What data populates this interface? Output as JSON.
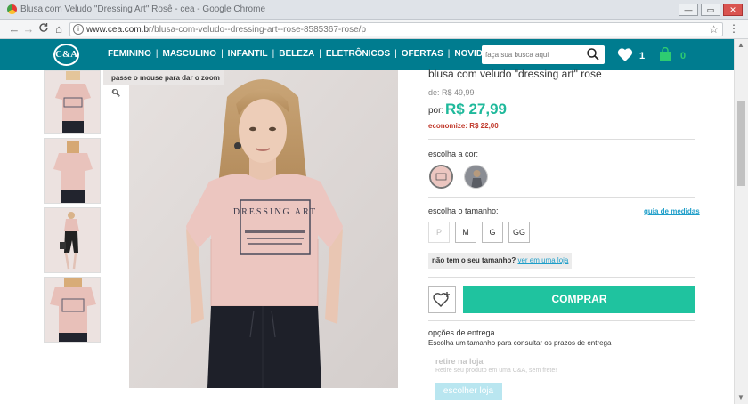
{
  "window": {
    "title": "Blusa com Veludo \"Dressing Art\" Rosê - cea - Google Chrome",
    "min_label": "—",
    "max_label": "▭",
    "close_label": "✕"
  },
  "browser": {
    "url_host": "www.cea.com.br",
    "url_path": "/blusa-com-veludo--dressing-art--rose-8585367-rose/p",
    "back": "←",
    "forward": "→",
    "reload": "C",
    "home": "⌂"
  },
  "site": {
    "logo": "C&A",
    "menu": [
      "FEMININO",
      "MASCULINO",
      "INFANTIL",
      "BELEZA",
      "ELETRÔNICOS",
      "OFERTAS",
      "NOVIDADES"
    ],
    "search_placeholder": "faça sua busca aqui",
    "wishlist_count": "1",
    "cart_count": "0"
  },
  "gallery": {
    "zoom_hint": "passe o mouse para dar o zoom",
    "thumbnails": [
      "front-view",
      "back-view",
      "full-body-view",
      "detail-view"
    ]
  },
  "product": {
    "title": "blusa com veludo \"dressing art\" rose",
    "old_price_label": "de: R$ 49,99",
    "por_label": "por:",
    "new_price": "R$ 27,99",
    "savings": "economize: R$ 22,00",
    "color_label": "escolha a cor:",
    "size_label": "escolha o tamanho:",
    "size_guide": "guia de medidas",
    "sizes": [
      {
        "label": "P",
        "available": false
      },
      {
        "label": "M",
        "available": true
      },
      {
        "label": "G",
        "available": true
      },
      {
        "label": "GG",
        "available": true
      }
    ],
    "no_size_text": "não tem o seu tamanho?",
    "no_size_link": "ver em uma loja",
    "buy_label": "COMPRAR",
    "delivery_title": "opções de entrega",
    "delivery_sub": "Escolha um tamanho para consultar os prazos de entrega",
    "pickup_title": "retire na loja",
    "pickup_sub": "Retire seu produto em uma C&A, sem frete!",
    "pickup_button": "escolher loja",
    "print_text": "DRESSING ART"
  }
}
